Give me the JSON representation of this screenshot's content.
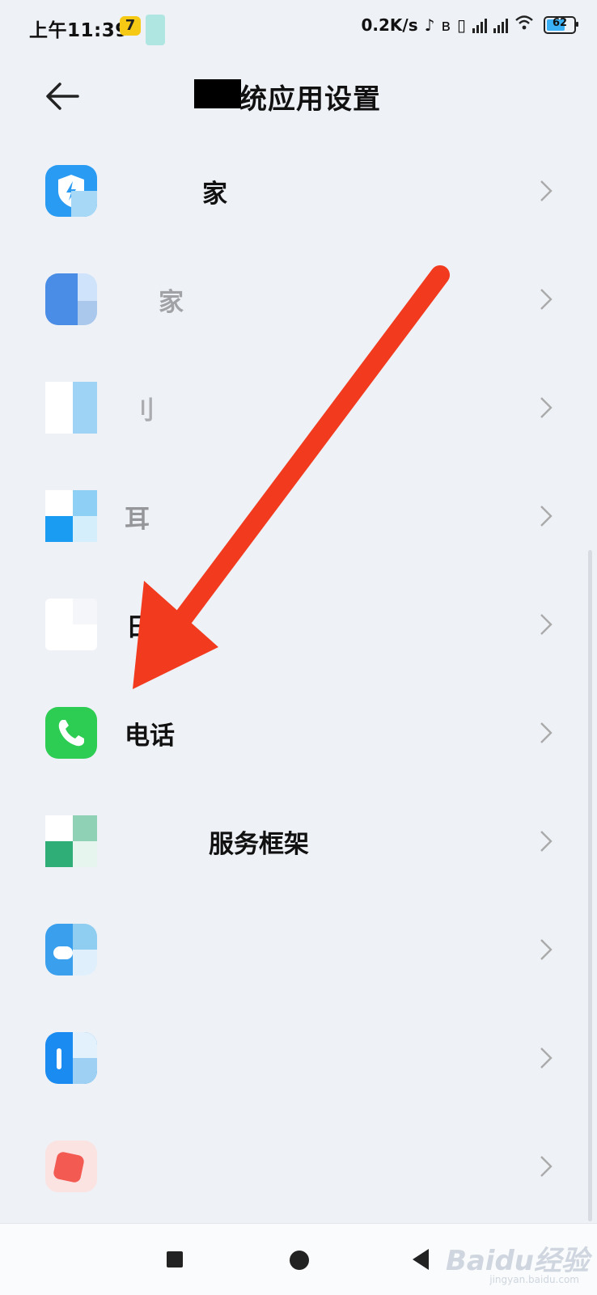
{
  "status_bar": {
    "time": "上午11:39",
    "app_icon_1": "7",
    "net_speed": "0.2K/s",
    "battery": "62"
  },
  "header": {
    "back_icon": "arrow-left-icon",
    "title": "统应用设置"
  },
  "list": {
    "items": [
      {
        "label": "家",
        "icon": "security-shield-icon",
        "color": "#2a9bf2"
      },
      {
        "label": "家",
        "icon": "blurred-app-icon",
        "color": "#4a8de6"
      },
      {
        "label": "刂",
        "icon": "blurred-app-icon",
        "color": "#9fd3f5"
      },
      {
        "label": "耳",
        "icon": "blurred-app-icon",
        "color": "#2a9bf2"
      },
      {
        "label": "日历",
        "icon": "calendar-icon",
        "color": "#ffffff"
      },
      {
        "label": "电话",
        "icon": "phone-icon",
        "color": "#2dcc52"
      },
      {
        "label": "服务框架",
        "icon": "blurred-app-icon",
        "color": "#2fae78"
      },
      {
        "label": "",
        "icon": "blurred-app-icon",
        "color": "#3aa0ee"
      },
      {
        "label": "",
        "icon": "blurred-app-icon",
        "color": "#1a8bf0"
      },
      {
        "label": "",
        "icon": "blurred-app-icon",
        "color": "#f25a52"
      }
    ]
  },
  "annotation": {
    "arrow_color": "#f23a1e"
  },
  "nav_bar": {
    "recent": "recent-apps-icon",
    "home": "home-icon",
    "back": "back-triangle-icon"
  },
  "watermark": {
    "text": "Baidu经验",
    "sub": "jingyan.baidu.com"
  }
}
